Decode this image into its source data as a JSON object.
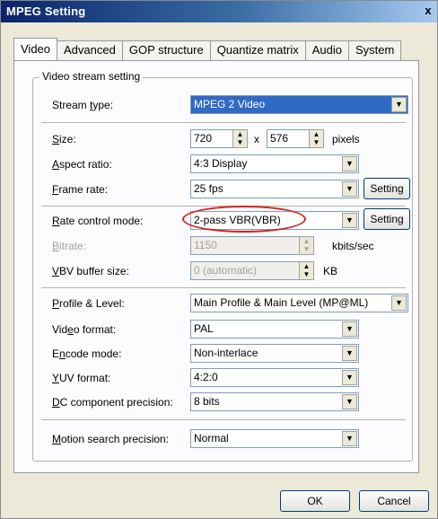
{
  "window": {
    "title": "MPEG Setting",
    "close_symbol": "x"
  },
  "tabs": [
    "Video",
    "Advanced",
    "GOP structure",
    "Quantize matrix",
    "Audio",
    "System"
  ],
  "group": {
    "title": "Video stream setting"
  },
  "stream_type": {
    "label_pre": "Stream ",
    "label_u": "t",
    "label_post": "ype:",
    "value": "MPEG 2 Video"
  },
  "size": {
    "label_u": "S",
    "label_post": "ize:",
    "width": "720",
    "separator": "x",
    "height": "576",
    "unit": "pixels"
  },
  "aspect_ratio": {
    "label_u": "A",
    "label_post": "spect ratio:",
    "value": "4:3 Display"
  },
  "frame_rate": {
    "label_u": "F",
    "label_post": "rame rate:",
    "value": "25 fps",
    "button": "Setting"
  },
  "rate_control": {
    "label_u": "R",
    "label_post": "ate control mode:",
    "value": "2-pass VBR(VBR)",
    "button": "Setting"
  },
  "bitrate": {
    "label_u": "B",
    "label_post": "itrate:",
    "value": "1150",
    "unit": "kbits/sec"
  },
  "vbv": {
    "label_u": "V",
    "label_post": "BV buffer size:",
    "value": "0 (automatic)",
    "unit": "KB"
  },
  "profile": {
    "label_u": "P",
    "label_post": "rofile & Level:",
    "value": "Main Profile & Main Level (MP@ML)"
  },
  "video_format": {
    "label_pre": "Vid",
    "label_u": "e",
    "label_post": "o format:",
    "value": "PAL"
  },
  "encode_mode": {
    "label_pre": "E",
    "label_u": "n",
    "label_post": "code mode:",
    "value": "Non-interlace"
  },
  "yuv_format": {
    "label_u": "Y",
    "label_post": "UV format:",
    "value": "4:2:0"
  },
  "dc_precision": {
    "label_u": "D",
    "label_post": "C component precision:",
    "value": "8 bits"
  },
  "motion": {
    "label_u": "M",
    "label_post": "otion search precision:",
    "value": "Normal"
  },
  "buttons": {
    "ok": "OK",
    "cancel": "Cancel"
  }
}
